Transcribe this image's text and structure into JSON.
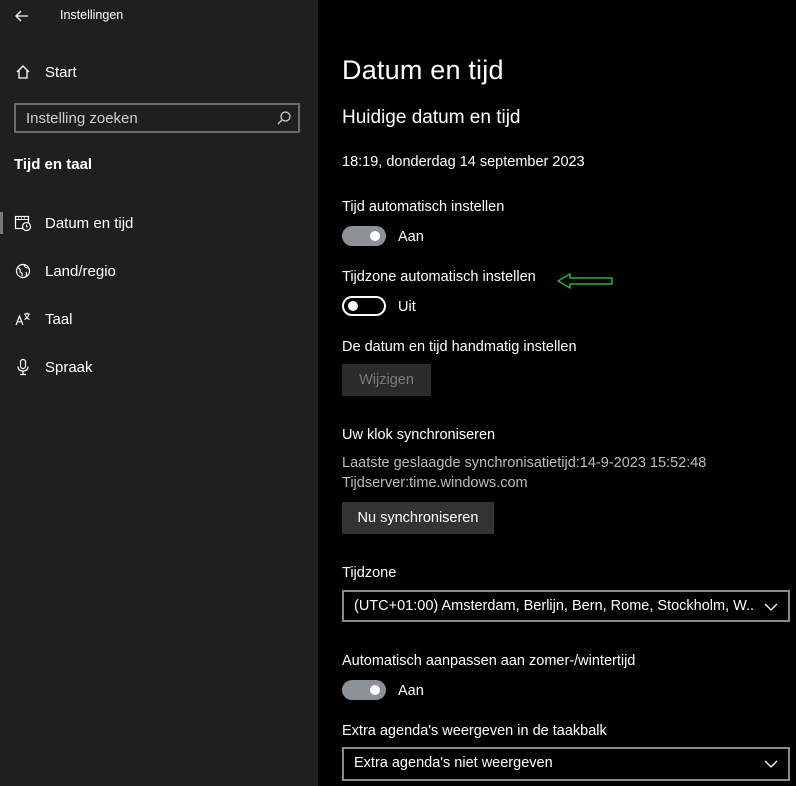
{
  "window": {
    "title": "Instellingen"
  },
  "sidebar": {
    "home_label": "Start",
    "search_placeholder": "Instelling zoeken",
    "section_title": "Tijd en taal",
    "items": [
      {
        "label": "Datum en tijd",
        "icon": "calendar-clock-icon",
        "active": true
      },
      {
        "label": "Land/regio",
        "icon": "globe-icon"
      },
      {
        "label": "Taal",
        "icon": "language-icon"
      },
      {
        "label": "Spraak",
        "icon": "microphone-icon"
      }
    ]
  },
  "main": {
    "title": "Datum en tijd",
    "subtitle": "Huidige datum en tijd",
    "current_datetime": "18:19, donderdag 14 september 2023",
    "auto_time": {
      "label": "Tijd automatisch instellen",
      "state": "Aan",
      "on": true
    },
    "auto_timezone": {
      "label": "Tijdzone automatisch instellen",
      "state": "Uit",
      "on": false
    },
    "manual": {
      "label": "De datum en tijd handmatig instellen",
      "button": "Wijzigen"
    },
    "sync": {
      "heading": "Uw klok synchroniseren",
      "last_sync": "Laatste geslaagde synchronisatietijd:14-9-2023 15:52:48",
      "server": "Tijdserver:time.windows.com",
      "button": "Nu synchroniseren"
    },
    "timezone": {
      "label": "Tijdzone",
      "value": "(UTC+01:00) Amsterdam, Berlijn, Bern, Rome, Stockholm, W..."
    },
    "dst": {
      "label": "Automatisch aanpassen aan zomer-/wintertijd",
      "state": "Aan",
      "on": true
    },
    "extra_calendars": {
      "label": "Extra agenda's weergeven in de taakbalk",
      "value": "Extra agenda's niet weergeven"
    }
  },
  "colors": {
    "sidebar_bg": "#1f1f1f",
    "main_bg": "#000000",
    "toggle_on": "#8b9197",
    "annotation_arrow": "#2fae3a"
  }
}
